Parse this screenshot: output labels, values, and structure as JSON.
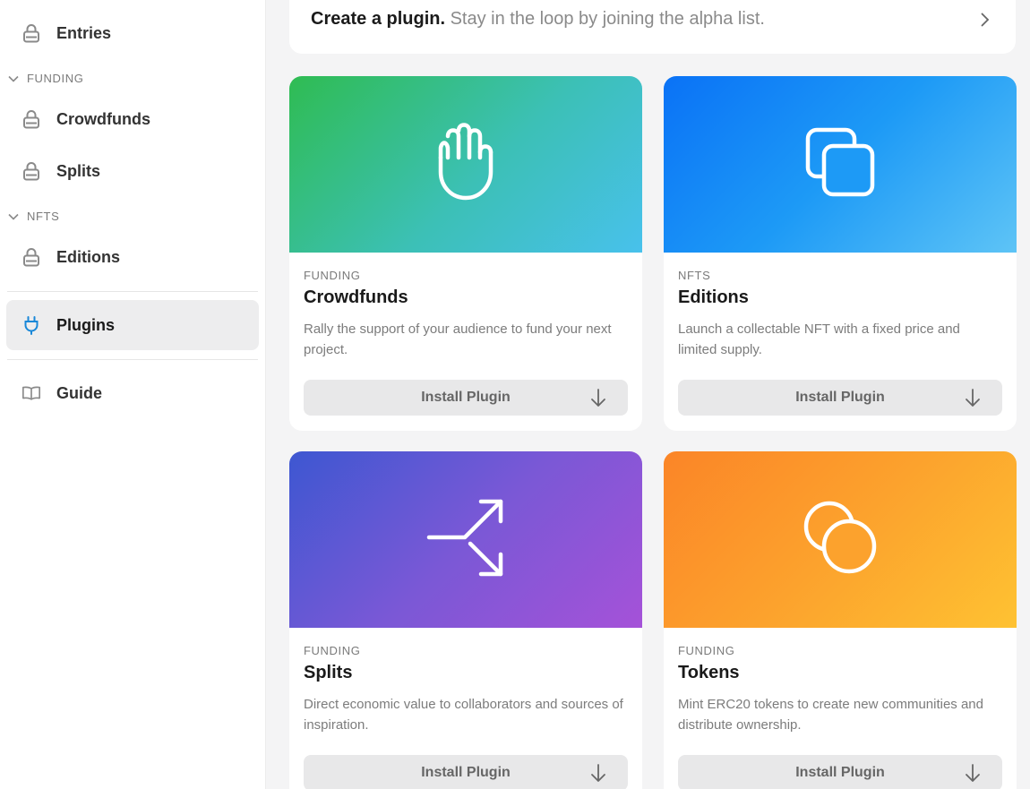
{
  "sidebar": {
    "entries": {
      "label": "Entries",
      "icon": "lock-icon"
    },
    "funding_section": {
      "label": "FUNDING",
      "icon": "chevron-down-icon"
    },
    "crowdfunds": {
      "label": "Crowdfunds",
      "icon": "lock-icon"
    },
    "splits": {
      "label": "Splits",
      "icon": "lock-icon"
    },
    "nfts_section": {
      "label": "NFTS",
      "icon": "chevron-down-icon"
    },
    "editions": {
      "label": "Editions",
      "icon": "lock-icon"
    },
    "plugins": {
      "label": "Plugins",
      "icon": "plug-icon",
      "active": true,
      "icon_color": "#1a88d8"
    },
    "guide": {
      "label": "Guide",
      "icon": "book-icon"
    }
  },
  "banner": {
    "title": "Create a plugin.",
    "subtitle": "Stay in the loop by joining the alpha list.",
    "icon": "chevron-right-icon"
  },
  "cards": [
    {
      "category": "FUNDING",
      "title": "Crowdfunds",
      "description": "Rally the support of your audience to fund your next project.",
      "icon": "raised-hand-icon",
      "button": "Install Plugin"
    },
    {
      "category": "NFTS",
      "title": "Editions",
      "description": "Launch a collectable NFT with a fixed price and limited supply.",
      "icon": "copy-icon",
      "button": "Install Plugin"
    },
    {
      "category": "FUNDING",
      "title": "Splits",
      "description": "Direct economic value to collaborators and sources of inspiration.",
      "icon": "split-arrows-icon",
      "button": "Install Plugin"
    },
    {
      "category": "FUNDING",
      "title": "Tokens",
      "description": "Mint ERC20 tokens to create new communities and distribute ownership.",
      "icon": "coins-icon",
      "button": "Install Plugin"
    }
  ]
}
